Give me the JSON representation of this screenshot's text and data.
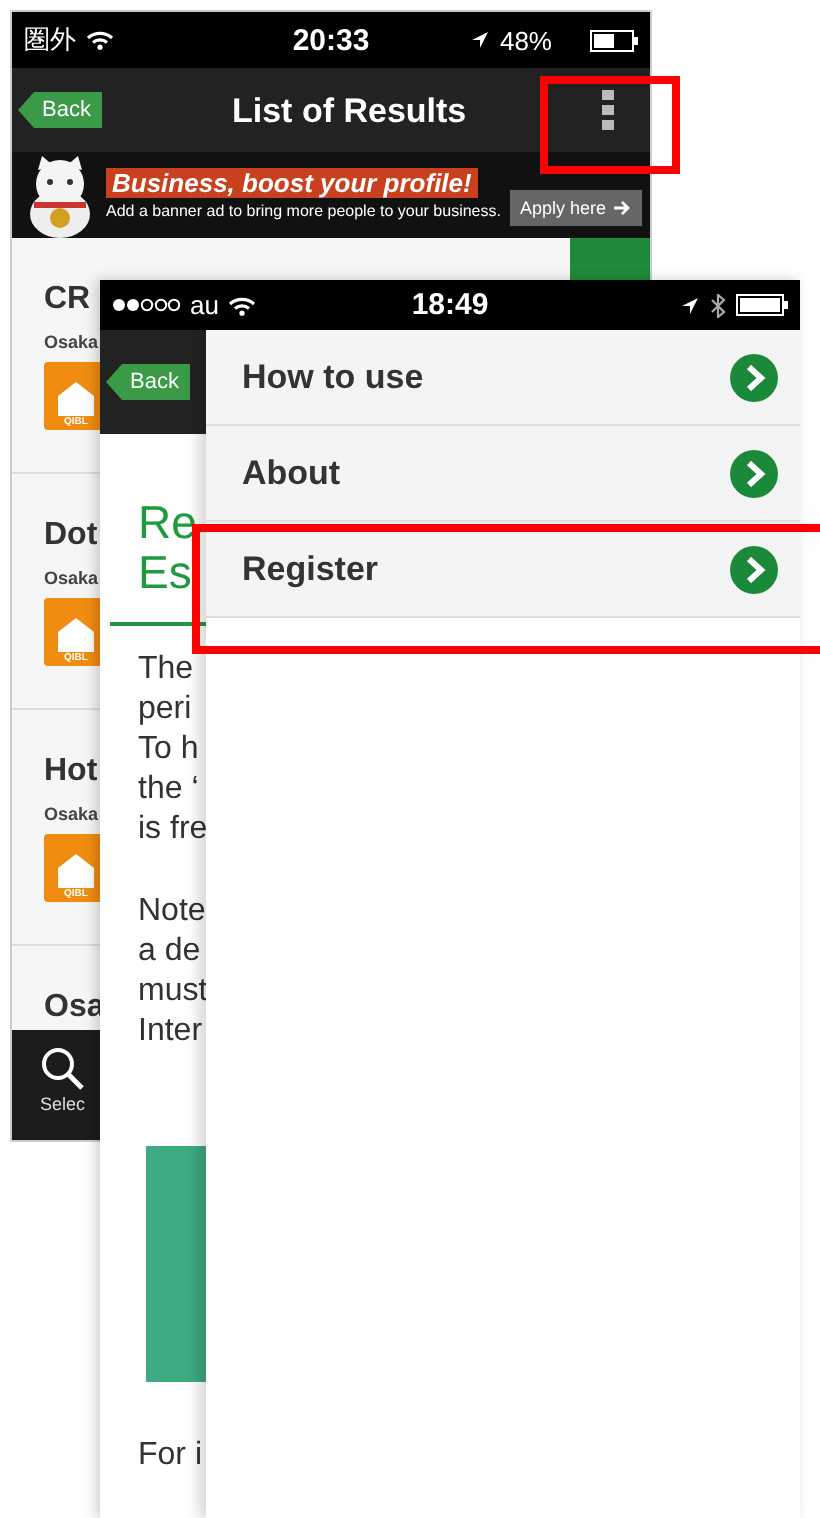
{
  "results_screen": {
    "status_bar": {
      "carrier": "圏外",
      "time": "20:33",
      "battery": "48%"
    },
    "nav_bar": {
      "back": "Back",
      "title": "List of Results",
      "menu_highlighted": true
    },
    "banner": {
      "headline": "Business, boost your profile!",
      "text": "Add a banner ad to bring more people to your business.",
      "button": "Apply here"
    },
    "results": [
      {
        "name": "CR",
        "area": "Osaka",
        "badge": "QIBL"
      },
      {
        "name": "Dot",
        "area": "Osaka",
        "badge": "QIBL"
      },
      {
        "name": "Hot",
        "area": "Osaka",
        "badge": "QIBL"
      },
      {
        "name": "Osa"
      }
    ],
    "tab_bar": [
      {
        "label": "Selec"
      }
    ]
  },
  "menu_screen": {
    "status_bar": {
      "carrier": "au",
      "time": "18:49"
    },
    "nav_bar": {
      "back": "Back"
    },
    "page": {
      "title_lines": [
        "Re",
        "Es"
      ],
      "paragraphs": [
        [
          "The",
          "peri",
          "To h",
          "the ‘",
          "is fre"
        ],
        [
          "Note",
          "a de",
          "must",
          "Inter"
        ]
      ],
      "footer_line": "For i"
    },
    "menu": [
      {
        "label": "How to use",
        "highlighted": false
      },
      {
        "label": "About",
        "highlighted": false
      },
      {
        "label": "Register",
        "highlighted": true
      }
    ]
  }
}
